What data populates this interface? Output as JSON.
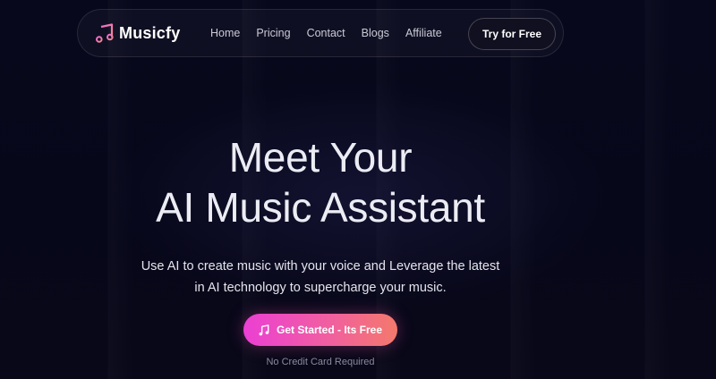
{
  "colors": {
    "background": "#07071a",
    "cta_gradient_start": "#ec3fd4",
    "cta_gradient_end": "#f4796c",
    "brand_icon": "#f05fa0"
  },
  "navbar": {
    "brand": {
      "icon": "music-note-icon",
      "name": "Musicfy"
    },
    "links": [
      {
        "label": "Home"
      },
      {
        "label": "Pricing"
      },
      {
        "label": "Contact"
      },
      {
        "label": "Blogs"
      },
      {
        "label": "Affiliate"
      }
    ],
    "cta_label": "Try for Free"
  },
  "hero": {
    "title_line1": "Meet Your",
    "title_line2": "AI Music Assistant",
    "subtitle_line1": "Use AI to create music with your voice and Leverage the latest",
    "subtitle_line2": "in AI technology to supercharge your music.",
    "cta": {
      "icon": "music-note-icon",
      "label": "Get Started - Its Free"
    },
    "note": "No Credit Card Required"
  }
}
